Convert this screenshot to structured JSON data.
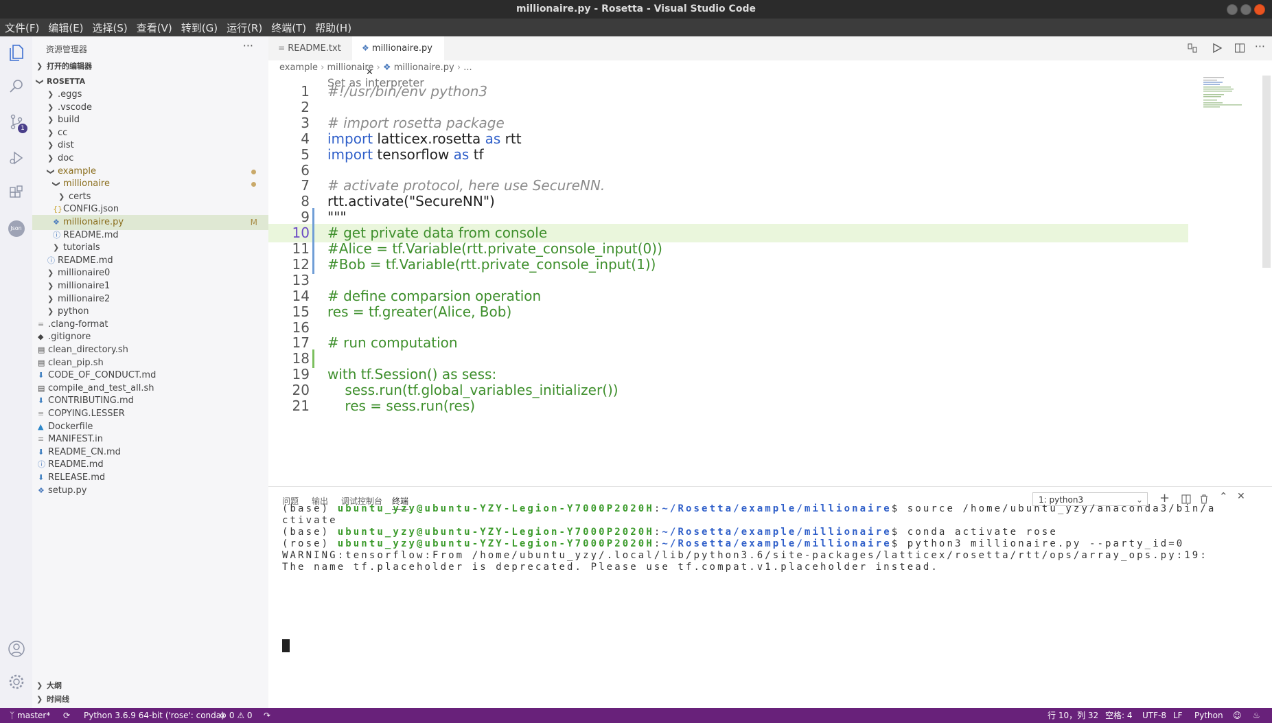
{
  "window": {
    "title": "millionaire.py - Rosetta - Visual Studio Code"
  },
  "menu": [
    "文件(F)",
    "编辑(E)",
    "选择(S)",
    "查看(V)",
    "转到(G)",
    "运行(R)",
    "终端(T)",
    "帮助(H)"
  ],
  "activity": {
    "items": [
      "explorer-icon",
      "search-icon",
      "source-control-icon",
      "run-debug-icon",
      "extensions-icon",
      "json-icon"
    ],
    "scm_badge": "1",
    "json_label": "Json"
  },
  "sidebar": {
    "title": "资源管理器",
    "more": "···",
    "open_editors": "打开的编辑器",
    "root": "ROSETTA",
    "tree": [
      {
        "label": ".eggs",
        "type": "folder"
      },
      {
        "label": ".vscode",
        "type": "folder"
      },
      {
        "label": "build",
        "type": "folder"
      },
      {
        "label": "cc",
        "type": "folder"
      },
      {
        "label": "dist",
        "type": "folder"
      },
      {
        "label": "doc",
        "type": "folder"
      },
      {
        "label": "example",
        "type": "folder-open"
      },
      {
        "label": "millionaire",
        "type": "folder-open"
      },
      {
        "label": "certs",
        "type": "folder"
      },
      {
        "label": "CONFIG.json",
        "type": "json"
      },
      {
        "label": "millionaire.py",
        "type": "python",
        "flag": "M"
      },
      {
        "label": "README.md",
        "type": "info"
      },
      {
        "label": "tutorials",
        "type": "folder"
      },
      {
        "label": "README.md",
        "type": "info"
      },
      {
        "label": "millionaire0",
        "type": "folder"
      },
      {
        "label": "millionaire1",
        "type": "folder"
      },
      {
        "label": "millionaire2",
        "type": "folder"
      },
      {
        "label": "python",
        "type": "folder"
      },
      {
        "label": ".clang-format",
        "type": "text"
      },
      {
        "label": ".gitignore",
        "type": "git"
      },
      {
        "label": "clean_directory.sh",
        "type": "shell"
      },
      {
        "label": "clean_pip.sh",
        "type": "shell"
      },
      {
        "label": "CODE_OF_CONDUCT.md",
        "type": "md"
      },
      {
        "label": "compile_and_test_all.sh",
        "type": "shell"
      },
      {
        "label": "CONTRIBUTING.md",
        "type": "md"
      },
      {
        "label": "COPYING.LESSER",
        "type": "text"
      },
      {
        "label": "Dockerfile",
        "type": "docker"
      },
      {
        "label": "MANIFEST.in",
        "type": "text"
      },
      {
        "label": "README_CN.md",
        "type": "md"
      },
      {
        "label": "README.md",
        "type": "info"
      },
      {
        "label": "RELEASE.md",
        "type": "md"
      },
      {
        "label": "setup.py",
        "type": "python"
      }
    ],
    "outline": "大纲",
    "timeline": "时间线"
  },
  "tabs": [
    {
      "label": "README.txt",
      "active": false
    },
    {
      "label": "millionaire.py",
      "active": true
    }
  ],
  "breadcrumb": [
    "example",
    "millionaire",
    "millionaire.py",
    "..."
  ],
  "editor": {
    "codelens": "Set as interpreter",
    "lines": [
      {
        "n": "1",
        "text": "#!/usr/bin/env python3"
      },
      {
        "n": "2",
        "text": ""
      },
      {
        "n": "3",
        "text": "# import rosetta package"
      },
      {
        "n": "4",
        "text": "import latticex.rosetta as rtt"
      },
      {
        "n": "5",
        "text": "import tensorflow as tf"
      },
      {
        "n": "6",
        "text": ""
      },
      {
        "n": "7",
        "text": "# activate protocol, here use SecureNN."
      },
      {
        "n": "8",
        "text": "rtt.activate(\"SecureNN\")"
      },
      {
        "n": "9",
        "text": "\"\"\""
      },
      {
        "n": "10",
        "text": "# get private data from console"
      },
      {
        "n": "11",
        "text": "#Alice = tf.Variable(rtt.private_console_input(0))"
      },
      {
        "n": "12",
        "text": "#Bob = tf.Variable(rtt.private_console_input(1))"
      },
      {
        "n": "13",
        "text": ""
      },
      {
        "n": "14",
        "text": "# define comparsion operation"
      },
      {
        "n": "15",
        "text": "res = tf.greater(Alice, Bob)"
      },
      {
        "n": "16",
        "text": ""
      },
      {
        "n": "17",
        "text": "# run computation"
      },
      {
        "n": "18",
        "text": ""
      },
      {
        "n": "19",
        "text": "with tf.Session() as sess:"
      },
      {
        "n": "20",
        "text": "    sess.run(tf.global_variables_initializer())"
      },
      {
        "n": "21",
        "text": "    res = sess.run(res)"
      }
    ]
  },
  "panel": {
    "tabs": [
      "问题",
      "输出",
      "调试控制台",
      "终端"
    ],
    "terminal_select": "1: python3",
    "terminal": [
      {
        "env": "(base)",
        "user": "ubuntu_yzy@ubuntu-YZY-Legion-Y7000P2020H",
        "path": "~/Rosetta/example/millionaire",
        "cmd": "$ source /home/ubuntu_yzy/anaconda3/bin/a"
      },
      {
        "plain": "ctivate"
      },
      {
        "env": "(base)",
        "user": "ubuntu_yzy@ubuntu-YZY-Legion-Y7000P2020H",
        "path": "~/Rosetta/example/millionaire",
        "cmd": "$ conda activate rose"
      },
      {
        "env": "(rose)",
        "user": "ubuntu_yzy@ubuntu-YZY-Legion-Y7000P2020H",
        "path": "~/Rosetta/example/millionaire",
        "cmd": "$ python3 millionaire.py --party_id=0"
      },
      {
        "plain": "WARNING:tensorflow:From /home/ubuntu_yzy/.local/lib/python3.6/site-packages/latticex/rosetta/rtt/ops/array_ops.py:19:"
      },
      {
        "plain": "The name tf.placeholder is deprecated. Please use tf.compat.v1.placeholder instead."
      }
    ]
  },
  "status": {
    "branch": "master*",
    "interpreter": "Python 3.6.9 64-bit ('rose': conda)",
    "problems": "⊗ 0 ⚠ 0",
    "position": "行 10，列 32",
    "spaces": "空格: 4",
    "encoding": "UTF-8",
    "eol": "LF",
    "language": "Python"
  },
  "colors": {
    "statusbar": "#68217a",
    "titlebar": "#2b2b2b",
    "menubar": "#3c3c3c"
  }
}
